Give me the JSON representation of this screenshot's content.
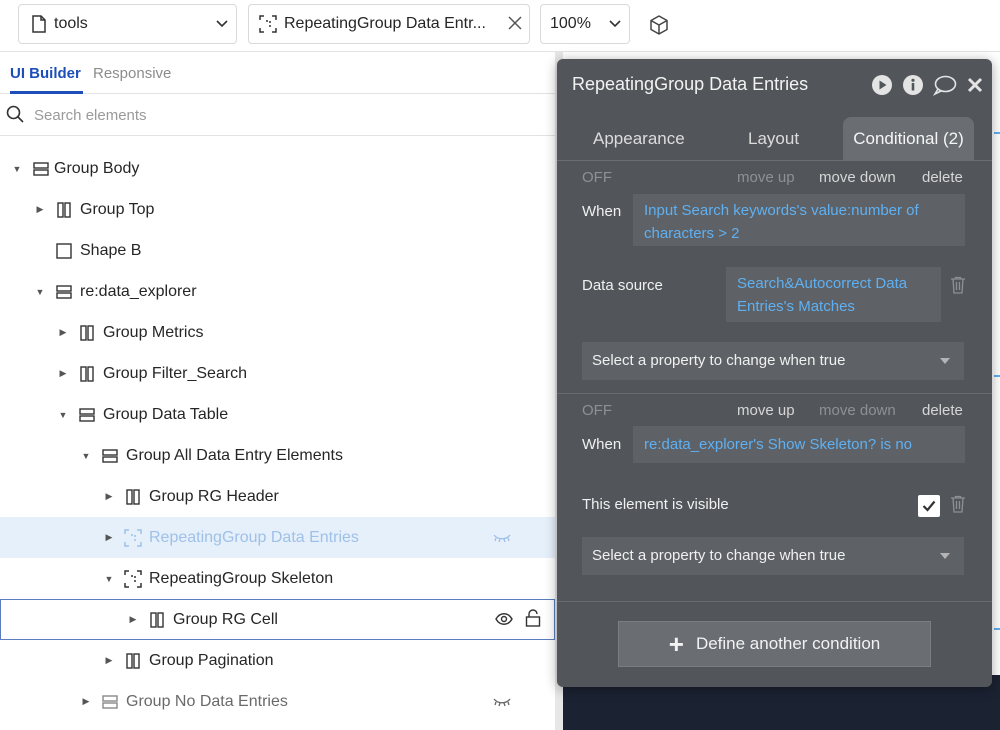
{
  "toolbar": {
    "page_label": "tools",
    "element_label": "RepeatingGroup Data Entr...",
    "zoom_label": "100%"
  },
  "left": {
    "tabs": [
      "UI Builder",
      "Responsive"
    ],
    "search_placeholder": "Search elements",
    "tree": [
      {
        "label": "Group Body"
      },
      {
        "label": "Group Top"
      },
      {
        "label": "Shape B"
      },
      {
        "label": "re:data_explorer"
      },
      {
        "label": "Group Metrics"
      },
      {
        "label": "Group Filter_Search"
      },
      {
        "label": "Group Data Table"
      },
      {
        "label": "Group All Data Entry Elements"
      },
      {
        "label": "Group RG Header"
      },
      {
        "label": "RepeatingGroup Data Entries"
      },
      {
        "label": "RepeatingGroup Skeleton"
      },
      {
        "label": "Group RG Cell"
      },
      {
        "label": "Group Pagination"
      },
      {
        "label": "Group No Data Entries"
      }
    ]
  },
  "editor": {
    "title": "RepeatingGroup Data Entries",
    "tabs": {
      "appearance": "Appearance",
      "layout": "Layout",
      "conditional": "Conditional (2)"
    },
    "conditions": [
      {
        "status": "OFF",
        "move_up": "move up",
        "move_down": "move down",
        "delete": "delete",
        "when_label": "When",
        "when_expr": "Input Search keywords's value:number of characters > 2",
        "property_label": "Data source",
        "property_value": "Search&Autocorrect Data Entries's Matches",
        "select_placeholder": "Select a property to change when true"
      },
      {
        "status": "OFF",
        "move_up": "move up",
        "move_down": "move down",
        "delete": "delete",
        "when_label": "When",
        "when_expr": "re:data_explorer's Show Skeleton? is no",
        "property_label": "This element is visible",
        "select_placeholder": "Select a property to change when true"
      }
    ],
    "define_button": "Define another condition"
  }
}
